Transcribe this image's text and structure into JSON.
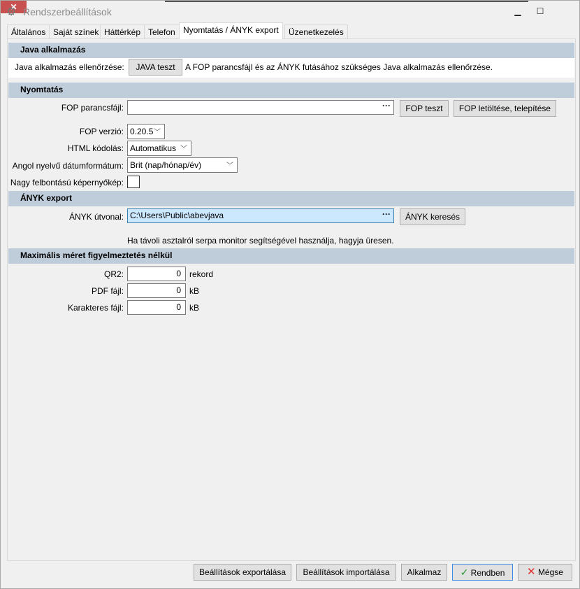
{
  "window": {
    "title": "Rendszerbeállítások",
    "icon": "gear-icon",
    "minimize": "▁",
    "maximize": "☐",
    "close": "✕"
  },
  "tabs": [
    {
      "label": "Általános"
    },
    {
      "label": "Saját színek"
    },
    {
      "label": "Háttérkép"
    },
    {
      "label": "Telefon"
    },
    {
      "label": "Nyomtatás / ÁNYK export",
      "active": true
    },
    {
      "label": "Üzenetkezelés"
    }
  ],
  "java": {
    "header": "Java alkalmazás",
    "check_label": "Java alkalmazás ellenőrzése:",
    "test_button": "JAVA teszt",
    "description": "A FOP parancsfájl és az ÁNYK futásához szükséges Java alkalmazás ellenőrzése."
  },
  "print": {
    "header": "Nyomtatás",
    "fop_file_label": "FOP parancsfájl:",
    "fop_file_value": "",
    "browse": "···",
    "fop_test": "FOP teszt",
    "fop_download": "FOP letöltése, telepítése",
    "fop_version_label": "FOP verzió:",
    "fop_version": "0.20.5",
    "html_enc_label": "HTML kódolás:",
    "html_enc": "Automatikus",
    "date_fmt_label": "Angol nyelvű dátumformátum:",
    "date_fmt": "Brit (nap/hónap/év)",
    "hires_label": "Nagy felbontású képernyőkép:",
    "hires_checked": false
  },
  "anyk": {
    "header": "ÁNYK export",
    "path_label": "ÁNYK útvonal:",
    "path_value": "C:\\Users\\Public\\abevjava",
    "browse": "···",
    "search_button": "ÁNYK keresés",
    "hint": "Ha távoli asztalról serpa monitor segítségével használja, hagyja üresen."
  },
  "maxsize": {
    "header": "Maximális méret figyelmeztetés nélkül",
    "rows": [
      {
        "label": "QR2:",
        "value": "0",
        "unit": "rekord"
      },
      {
        "label": "PDF fájl:",
        "value": "0",
        "unit": "kB"
      },
      {
        "label": "Karakteres fájl:",
        "value": "0",
        "unit": "kB"
      }
    ]
  },
  "footer": {
    "export": "Beállítások exportálása",
    "import": "Beállítások importálása",
    "apply": "Alkalmaz",
    "ok": "Rendben",
    "cancel": "Mégse"
  },
  "colors": {
    "header_bg": "#bfcddb",
    "close_bg": "#c75050",
    "ok_check": "#2e9b3a",
    "cancel_x": "#e03030",
    "path_bg": "#cce8ff"
  }
}
